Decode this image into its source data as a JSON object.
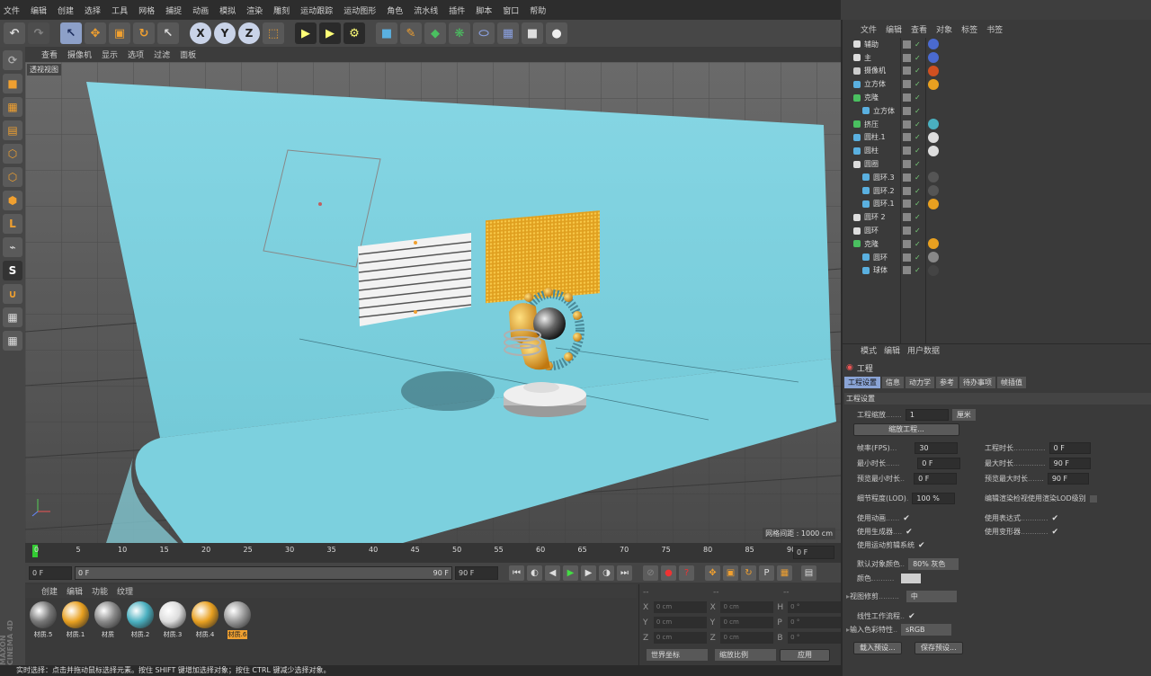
{
  "menubar": [
    "文件",
    "编辑",
    "创建",
    "选择",
    "工具",
    "网格",
    "捕捉",
    "动画",
    "模拟",
    "渲染",
    "雕刻",
    "运动跟踪",
    "运动图形",
    "角色",
    "流水线",
    "插件",
    "脚本",
    "窗口",
    "帮助"
  ],
  "viewport": {
    "menu": [
      "查看",
      "摄像机",
      "显示",
      "选项",
      "过滤",
      "面板"
    ],
    "label": "透视视图",
    "grid_info": "网格间距 : 1000 cm"
  },
  "timeline": {
    "ticks": [
      "0",
      "5",
      "10",
      "15",
      "20",
      "25",
      "30",
      "35",
      "40",
      "45",
      "50",
      "55",
      "60",
      "65",
      "70",
      "75",
      "80",
      "85",
      "90"
    ],
    "current": "0 F",
    "start": "0 F",
    "range_start": "0 F",
    "range_end": "90 F",
    "end": "90 F"
  },
  "materials": {
    "menu": [
      "创建",
      "编辑",
      "功能",
      "纹理"
    ],
    "items": [
      {
        "name": "材质.5",
        "color": "#777"
      },
      {
        "name": "材质.1",
        "color": "#e8a020"
      },
      {
        "name": "材质",
        "color": "#888"
      },
      {
        "name": "材质.2",
        "color": "#4ab0c0"
      },
      {
        "name": "材质.3",
        "color": "#ddd"
      },
      {
        "name": "材质.4",
        "color": "#e8a020"
      },
      {
        "name": "材质.6",
        "color": "#999"
      }
    ]
  },
  "coords": {
    "headers": [
      "--",
      "--",
      "--"
    ],
    "rows": [
      {
        "a": "X",
        "av": "0 cm",
        "b": "X",
        "bv": "0 cm",
        "c": "H",
        "cv": "0 °"
      },
      {
        "a": "Y",
        "av": "0 cm",
        "b": "Y",
        "bv": "0 cm",
        "c": "P",
        "cv": "0 °"
      },
      {
        "a": "Z",
        "av": "0 cm",
        "b": "Z",
        "bv": "0 cm",
        "c": "B",
        "cv": "0 °"
      }
    ],
    "world": "世界坐标",
    "scale": "缩放比例",
    "apply": "应用"
  },
  "status": "实时选择：点击并拖动鼠标选择元素。按住 SHIFT 键增加选择对象；按住 CTRL 键减少选择对象。",
  "brand": "MAXON CINEMA 4D",
  "objects": {
    "menu": [
      "文件",
      "编辑",
      "查看",
      "对象",
      "标签",
      "书签"
    ],
    "items": [
      {
        "name": "辅助",
        "indent": 0,
        "icon": "#ddd",
        "tag": "#4a6ad0"
      },
      {
        "name": "主",
        "indent": 0,
        "icon": "#ddd",
        "tag": "#4a6ad0"
      },
      {
        "name": "摄像机",
        "indent": 0,
        "icon": "#ccc",
        "tag": "#d05020"
      },
      {
        "name": "立方体",
        "indent": 0,
        "icon": "#5ab0e0",
        "tag": "#e8a020"
      },
      {
        "name": "克隆",
        "indent": 0,
        "icon": "#4ac060",
        "tag": ""
      },
      {
        "name": "立方体",
        "indent": 1,
        "icon": "#5ab0e0",
        "tag": ""
      },
      {
        "name": "挤压",
        "indent": 0,
        "icon": "#4ac060",
        "tag": "#4ab0c0"
      },
      {
        "name": "圆柱.1",
        "indent": 0,
        "icon": "#5ab0e0",
        "tag": "#ddd"
      },
      {
        "name": "圆柱",
        "indent": 0,
        "icon": "#5ab0e0",
        "tag": "#ddd"
      },
      {
        "name": "圆圈",
        "indent": 0,
        "icon": "#ddd",
        "tag": ""
      },
      {
        "name": "圆环.3",
        "indent": 1,
        "icon": "#5ab0e0",
        "tag": "#555"
      },
      {
        "name": "圆环.2",
        "indent": 1,
        "icon": "#5ab0e0",
        "tag": "#555"
      },
      {
        "name": "圆环.1",
        "indent": 1,
        "icon": "#5ab0e0",
        "tag": "#e8a020"
      },
      {
        "name": "圆环 2",
        "indent": 0,
        "icon": "#ddd",
        "tag": ""
      },
      {
        "name": "圆环",
        "indent": 0,
        "icon": "#ddd",
        "tag": ""
      },
      {
        "name": "克隆",
        "indent": 0,
        "icon": "#4ac060",
        "tag": "#e8a020"
      },
      {
        "name": "圆环",
        "indent": 1,
        "icon": "#5ab0e0",
        "tag": "#888"
      },
      {
        "name": "球体",
        "indent": 1,
        "icon": "#5ab0e0",
        "tag": "#444"
      }
    ]
  },
  "attributes": {
    "menu": [
      "模式",
      "编辑",
      "用户数据"
    ],
    "title": "工程",
    "tabs": [
      "工程设置",
      "信息",
      "动力学",
      "参考",
      "待办事项",
      "帧插值"
    ],
    "section": "工程设置",
    "scale_label": "工程缩放",
    "scale_value": "1",
    "scale_unit": "厘米",
    "scale_button": "缩放工程...",
    "fps_label": "帧率(FPS)",
    "fps_value": "30",
    "duration_label": "工程时长",
    "duration_value": "0 F",
    "min_label": "最小时长",
    "min_value": "0 F",
    "max_label": "最大时长",
    "max_value": "90 F",
    "pmin_label": "预览最小时长",
    "pmin_value": "0 F",
    "pmax_label": "预览最大时长",
    "pmax_value": "90 F",
    "lod_label": "细节程度(LOD)",
    "lod_value": "100 %",
    "lod_render_label": "编辑渲染检视使用渲染LOD级别",
    "anim_label": "使用动画",
    "expr_label": "使用表达式",
    "gen_label": "使用生成器",
    "deform_label": "使用变形器",
    "motion_label": "使用运动剪辑系统",
    "objcolor_label": "默认对象颜色",
    "objcolor_value": "80% 灰色",
    "color_label": "颜色",
    "clip_label": "视图修剪",
    "clip_value": "中",
    "linear_label": "线性工作流程",
    "input_label": "输入色彩特性",
    "input_value": "sRGB",
    "load_preset": "载入预设...",
    "save_preset": "保存预设..."
  }
}
